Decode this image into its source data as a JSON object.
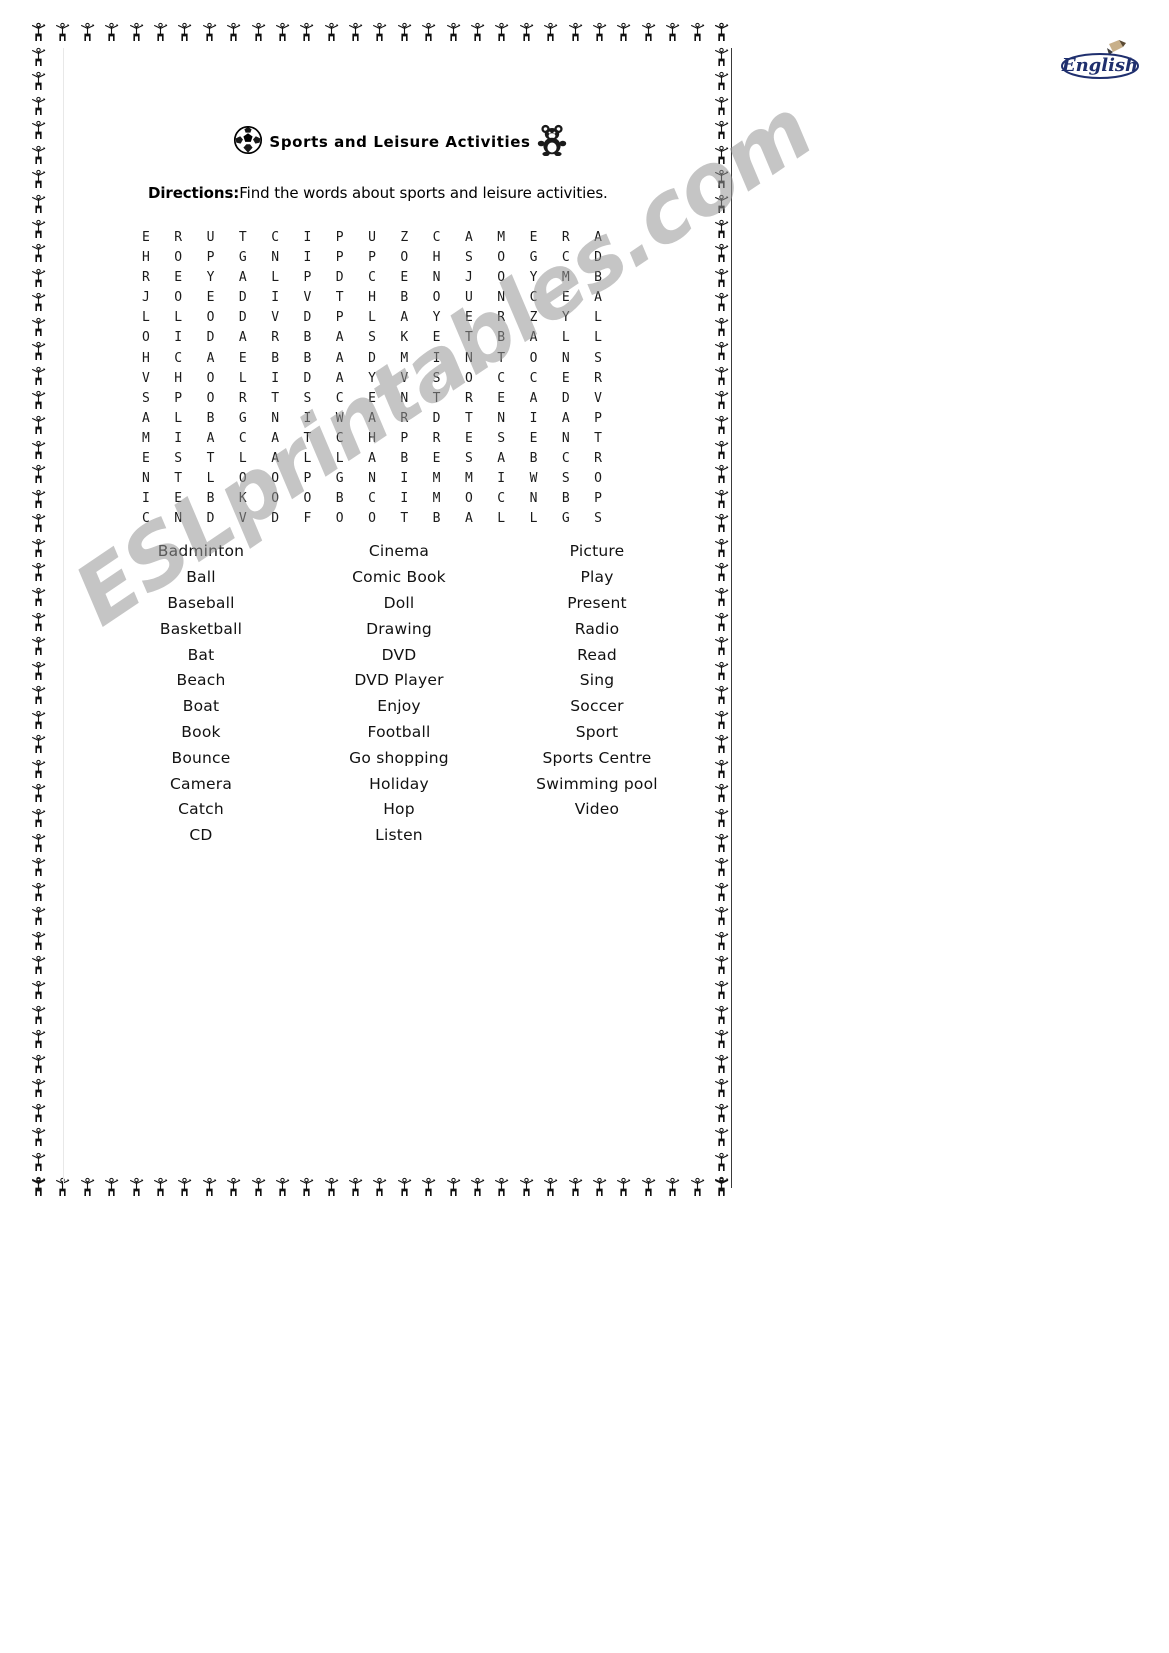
{
  "page": {
    "background_color": "#ffffff",
    "border_motif": "cheerleader-figure"
  },
  "logo": {
    "name": "english-logo",
    "text": "English",
    "color": "#1f2f6e"
  },
  "watermark": {
    "text": "ESLprintables.com",
    "color": "#969696"
  },
  "header": {
    "title": "Sports and Leisure Activities",
    "left_icon": "soccer-ball-icon",
    "right_icon": "teddy-bear-icon"
  },
  "directions": {
    "label": "Directions:",
    "text": "Find the words about sports and leisure activities."
  },
  "puzzle": {
    "rows": 15,
    "cols": 15,
    "grid": [
      [
        "E",
        "R",
        "U",
        "T",
        "C",
        "I",
        "P",
        "U",
        "Z",
        "C",
        "A",
        "M",
        "E",
        "R",
        "A"
      ],
      [
        "H",
        "O",
        "P",
        "G",
        "N",
        "I",
        "P",
        "P",
        "O",
        "H",
        "S",
        "O",
        "G",
        "C",
        "D"
      ],
      [
        "R",
        "E",
        "Y",
        "A",
        "L",
        "P",
        "D",
        "C",
        "E",
        "N",
        "J",
        "O",
        "Y",
        "M",
        "B"
      ],
      [
        "J",
        "O",
        "E",
        "D",
        "I",
        "V",
        "T",
        "H",
        "B",
        "O",
        "U",
        "N",
        "C",
        "E",
        "A"
      ],
      [
        "L",
        "L",
        "O",
        "D",
        "V",
        "D",
        "P",
        "L",
        "A",
        "Y",
        "E",
        "R",
        "Z",
        "Y",
        "L"
      ],
      [
        "O",
        "I",
        "D",
        "A",
        "R",
        "B",
        "A",
        "S",
        "K",
        "E",
        "T",
        "B",
        "A",
        "L",
        "L"
      ],
      [
        "H",
        "C",
        "A",
        "E",
        "B",
        "B",
        "A",
        "D",
        "M",
        "I",
        "N",
        "T",
        "O",
        "N",
        "S"
      ],
      [
        "V",
        "H",
        "O",
        "L",
        "I",
        "D",
        "A",
        "Y",
        "V",
        "S",
        "O",
        "C",
        "C",
        "E",
        "R"
      ],
      [
        "S",
        "P",
        "O",
        "R",
        "T",
        "S",
        "C",
        "E",
        "N",
        "T",
        "R",
        "E",
        "A",
        "D",
        "V"
      ],
      [
        "A",
        "L",
        "B",
        "G",
        "N",
        "I",
        "W",
        "A",
        "R",
        "D",
        "T",
        "N",
        "I",
        "A",
        "P"
      ],
      [
        "M",
        "I",
        "A",
        "C",
        "A",
        "T",
        "C",
        "H",
        "P",
        "R",
        "E",
        "S",
        "E",
        "N",
        "T"
      ],
      [
        "E",
        "S",
        "T",
        "L",
        "A",
        "L",
        "L",
        "A",
        "B",
        "E",
        "S",
        "A",
        "B",
        "C",
        "R"
      ],
      [
        "N",
        "T",
        "L",
        "O",
        "O",
        "P",
        "G",
        "N",
        "I",
        "M",
        "M",
        "I",
        "W",
        "S",
        "O"
      ],
      [
        "I",
        "E",
        "B",
        "K",
        "O",
        "O",
        "B",
        "C",
        "I",
        "M",
        "O",
        "C",
        "N",
        "B",
        "P"
      ],
      [
        "C",
        "N",
        "D",
        "V",
        "D",
        "F",
        "O",
        "O",
        "T",
        "B",
        "A",
        "L",
        "L",
        "G",
        "S"
      ]
    ]
  },
  "wordlist": {
    "columns": [
      {
        "name": "word-column-1",
        "words": [
          "Badminton",
          "Ball",
          "Baseball",
          "Basketball",
          "Bat",
          "Beach",
          "Boat",
          "Book",
          "Bounce",
          "Camera",
          "Catch",
          "CD"
        ]
      },
      {
        "name": "word-column-2",
        "words": [
          "Cinema",
          "Comic Book",
          "Doll",
          "Drawing",
          "DVD",
          "DVD Player",
          "Enjoy",
          "Football",
          "Go shopping",
          "Holiday",
          "Hop",
          "Listen"
        ]
      },
      {
        "name": "word-column-3",
        "words": [
          "Picture",
          "Play",
          "Present",
          "Radio",
          "Read",
          "Sing",
          "Soccer",
          "Sport",
          "Sports Centre",
          "Swimming pool",
          "Video"
        ]
      }
    ]
  }
}
